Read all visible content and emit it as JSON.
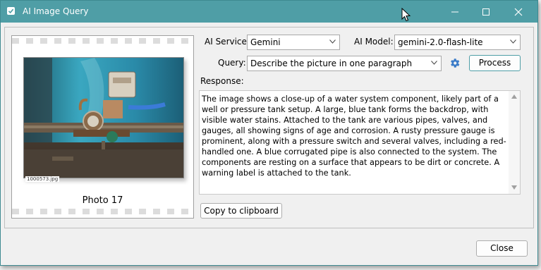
{
  "window": {
    "title": "AI Image Query",
    "accent_color": "#4f9ea6",
    "controls": {
      "minimize_icon": "minimize-icon",
      "maximize_icon": "maximize-icon",
      "close_icon": "close-icon"
    }
  },
  "photo": {
    "code": "1000573.jpg",
    "caption": "Photo 17"
  },
  "form": {
    "service_label": "AI Service:",
    "service_value": "Gemini",
    "model_label": "AI Model:",
    "model_value": "gemini-2.0-flash-lite",
    "query_label": "Query:",
    "query_value": "Describe the picture in one paragraph",
    "settings_icon": "gear-icon",
    "process_label": "Process"
  },
  "response": {
    "label": "Response:",
    "text": "The image shows a close-up of a water system component, likely part of a well or pressure tank setup. A large, blue tank forms the backdrop, with visible water stains. Attached to the tank are various pipes, valves, and gauges, all showing signs of age and corrosion. A rusty pressure gauge is prominent, along with a pressure switch and several valves, including a red-handled one. A blue corrugated pipe is also connected to the system. The components are resting on a surface that appears to be dirt or concrete. A warning label is attached to the tank."
  },
  "actions": {
    "copy_label": "Copy to clipboard",
    "close_label": "Close"
  }
}
